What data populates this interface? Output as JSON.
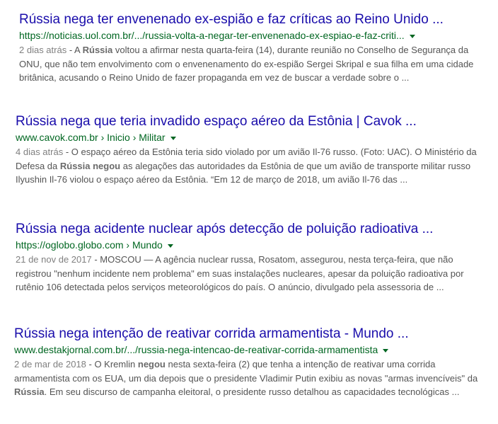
{
  "results": [
    {
      "title": "Rússia nega ter envenenado ex-espião e faz críticas ao Reino Unido ...",
      "url": "https://noticias.uol.com.br/.../russia-volta-a-negar-ter-envenenado-ex-espiao-e-faz-criti...",
      "date": "2 dias atrás",
      "snippet_parts": [
        {
          "text": " - A ",
          "bold": false
        },
        {
          "text": "Rússia",
          "bold": true
        },
        {
          "text": " voltou a afirmar nesta quarta-feira (14), durante reunião no Conselho de Segurança da ONU, que não tem envolvimento com o envenenamento do ex-espião Sergei Skripal e sua filha em uma cidade britânica, acusando o Reino Unido de fazer propaganda em vez de buscar a verdade sobre o ...",
          "bold": false
        }
      ]
    },
    {
      "title": "Rússia nega que teria invadido espaço aéreo da Estônia | Cavok ...",
      "url": "www.cavok.com.br › Inicio › Militar",
      "date": "4 dias atrás",
      "snippet_parts": [
        {
          "text": " - O espaço aéreo da Estônia teria sido violado por um avião Il-76 russo. (Foto: UAC). O Ministério da Defesa da ",
          "bold": false
        },
        {
          "text": "Rússia negou",
          "bold": true
        },
        {
          "text": " as alegações das autoridades da Estônia de que um avião de transporte militar russo Ilyushin Il-76 violou o espaço aéreo da Estônia. “Em 12 de março de 2018, um avião Il-76 das ...",
          "bold": false
        }
      ]
    },
    {
      "title": "Rússia nega acidente nuclear após detecção de poluição radioativa ...",
      "url": "https://oglobo.globo.com › Mundo",
      "date": "21 de nov de 2017",
      "snippet_parts": [
        {
          "text": " - MOSCOU — A agência nuclear russa, Rosatom, assegurou, nesta terça-feira, que não registrou \"nenhum incidente nem problema\" em suas instalações nucleares, apesar da poluição radioativa por rutênio 106 detectada pelos serviços meteorológicos do país. O anúncio, divulgado pela assessoria de ...",
          "bold": false
        }
      ]
    },
    {
      "title": "Rússia nega intenção de reativar corrida armamentista - Mundo ...",
      "url": "www.destakjornal.com.br/.../russia-nega-intencao-de-reativar-corrida-armamentista",
      "date": "2 de mar de 2018",
      "snippet_parts": [
        {
          "text": " - O Kremlin ",
          "bold": false
        },
        {
          "text": "negou",
          "bold": true
        },
        {
          "text": " nesta sexta-feira (2) que tenha a intenção de reativar uma corrida armamentista com os EUA, um dia depois que o presidente Vladimir Putin exibiu as novas \"armas invencíveis\" da ",
          "bold": false
        },
        {
          "text": "Rússia",
          "bold": true
        },
        {
          "text": ". Em seu discurso de campanha eleitoral, o presidente russo detalhou as capacidades tecnológicas ...",
          "bold": false
        }
      ]
    }
  ],
  "colors": {
    "title": "#1a0dab",
    "url": "#006621",
    "snippet": "#545454",
    "date": "#808080"
  },
  "icons": {
    "url_menu": "chevron-down-icon"
  }
}
